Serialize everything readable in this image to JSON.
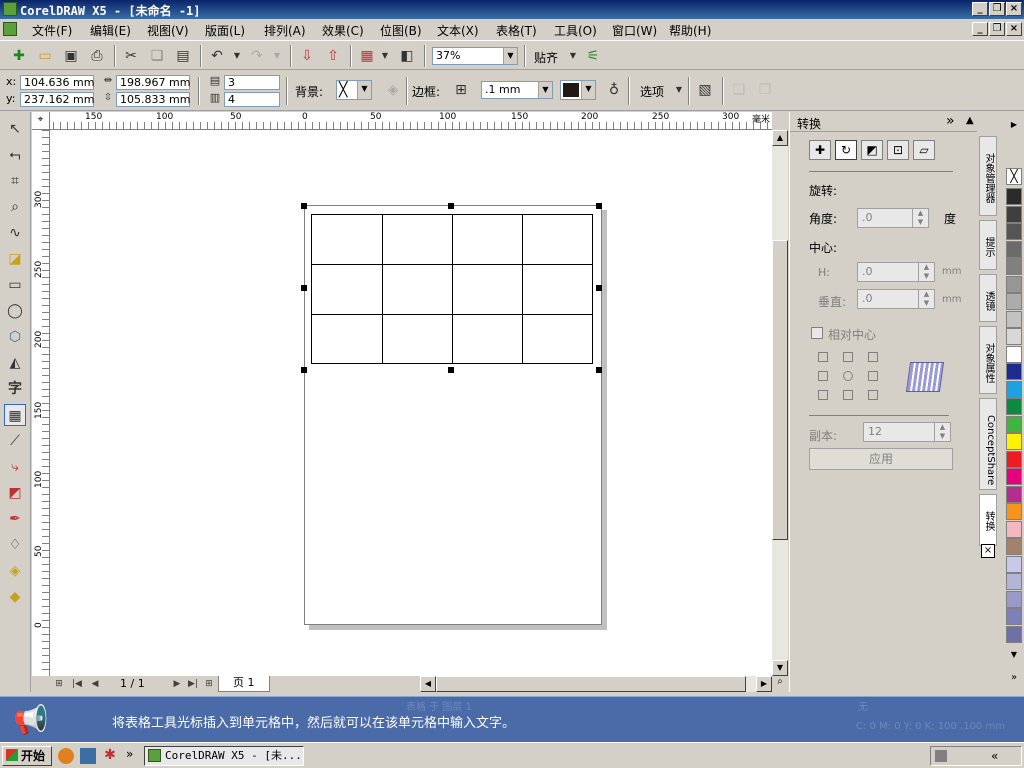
{
  "window": {
    "title": "CorelDRAW X5 - [未命名 -1]"
  },
  "menu": [
    "文件(F)",
    "编辑(E)",
    "视图(V)",
    "版面(L)",
    "排列(A)",
    "效果(C)",
    "位图(B)",
    "文本(X)",
    "表格(T)",
    "工具(O)",
    "窗口(W)",
    "帮助(H)"
  ],
  "toolbar1": {
    "zoom": "37%",
    "snap_label": "贴齐"
  },
  "toolbar2": {
    "x_label": "x:",
    "x_value": "104.636 mm",
    "y_label": "y:",
    "y_value": "237.162 mm",
    "width_value": "198.967 mm",
    "height_value": "105.833 mm",
    "rows": "3",
    "cols": "4",
    "background_label": "背景:",
    "border_label": "边框:",
    "border_width": ".1 mm",
    "options_label": "选项"
  },
  "ruler": {
    "top_labels": [
      "150",
      "100",
      "50",
      "0",
      "50",
      "100",
      "150",
      "200",
      "250",
      "300"
    ],
    "unit": "毫米",
    "left_labels": [
      "300",
      "250",
      "200",
      "150",
      "100",
      "50",
      "0"
    ]
  },
  "pagenav": {
    "counter": "1 / 1",
    "tab": "页 1"
  },
  "docker": {
    "title": "转换",
    "rotate_heading": "旋转:",
    "angle_label": "角度:",
    "angle_value": ".0",
    "angle_unit": "度",
    "center_heading": "中心:",
    "h_label": "H:",
    "h_value": ".0",
    "h_unit": "mm",
    "v_label": "垂直:",
    "v_value": ".0",
    "v_unit": "mm",
    "relative_center": "相对中心",
    "copies_label": "副本:",
    "copies_value": "12",
    "apply": "应用"
  },
  "sidetabs": [
    "对象管理器",
    "提示",
    "透镜",
    "对象属性",
    "ConceptShare",
    "转换"
  ],
  "palette": [
    "#2b2b2b",
    "#3f3f3f",
    "#555555",
    "#6b6b6b",
    "#808080",
    "#969696",
    "#acacac",
    "#c2c2c2",
    "#d8d8d8",
    "#ffffff",
    "#1c2b8c",
    "#1da1e0",
    "#0e8a3e",
    "#40b440",
    "#fff200",
    "#ed1c24",
    "#e6007e",
    "#b32e8e",
    "#f7941d",
    "#f4b8c0",
    "#a0826d",
    "#c8c8e8",
    "#b4b4d8",
    "#9a9ac8",
    "#8080b8",
    "#7070a8"
  ],
  "banner": {
    "message": "将表格工具光标插入到单元格中，然后就可以在该单元格中输入文字。",
    "ghost_status": "表格 于 图层 1",
    "ghost_fill": "无",
    "ghost_outline": "C: 0 M: 0 Y: 0 K: 100  .100 mm"
  },
  "taskbar": {
    "start": "开始",
    "item": "CorelDRAW X5 - [未..."
  },
  "colors": {
    "title_start": "#0a246a",
    "title_end": "#3a6ea5",
    "banner": "#4a6aa8",
    "selection": "#316ac5"
  }
}
